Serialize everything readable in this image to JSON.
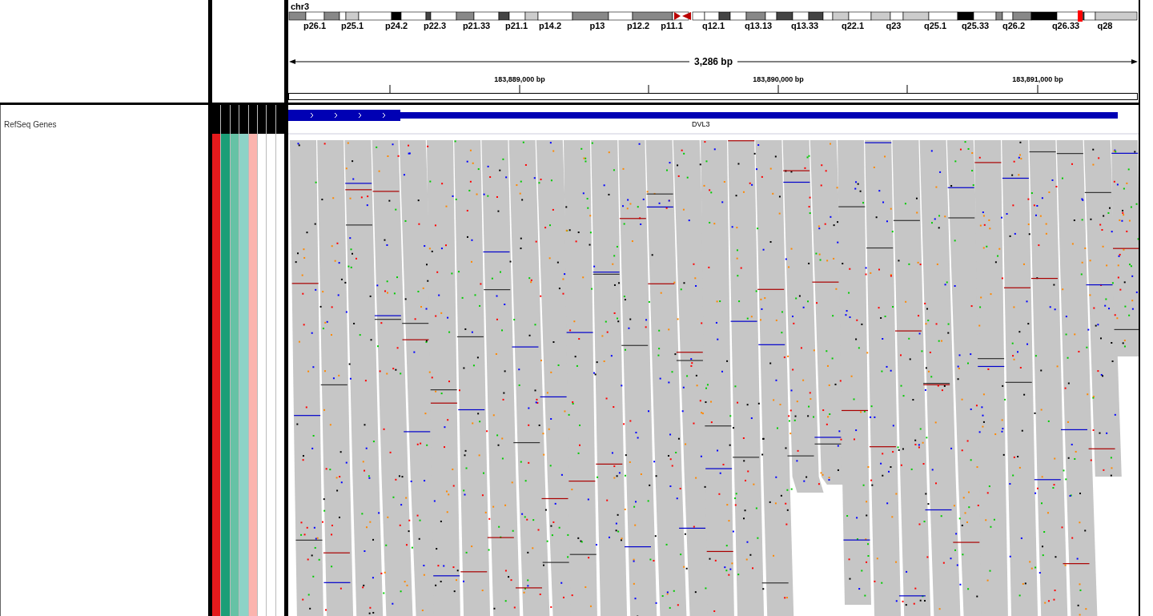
{
  "chromosome": {
    "name": "chr3",
    "bands": [
      "p26.1",
      "p25.1",
      "p24.2",
      "p22.3",
      "p21.33",
      "p21.1",
      "p14.2",
      "p13",
      "p12.2",
      "p11.1",
      "q12.1",
      "q13.13",
      "q13.33",
      "q22.1",
      "q23",
      "q25.1",
      "q25.33",
      "q26.2",
      "q26.33",
      "q28"
    ]
  },
  "ruler": {
    "span": "3,286 bp",
    "ticks": [
      "183,889,000 bp",
      "183,890,000 bp",
      "183,891,000 bp"
    ]
  },
  "tracks": [
    {
      "name": "RefSeq Genes",
      "gene": "DVL3"
    }
  ],
  "attributes": [
    {
      "color": "#e41a1c"
    },
    {
      "color": "#1b9e77"
    },
    {
      "color": "#66c2a5"
    },
    {
      "color": "#8dd3c7"
    },
    {
      "color": "#fbb4ae"
    },
    {
      "color": "#ffffff"
    },
    {
      "color": "#ffffff"
    },
    {
      "color": "#ffffff"
    }
  ]
}
